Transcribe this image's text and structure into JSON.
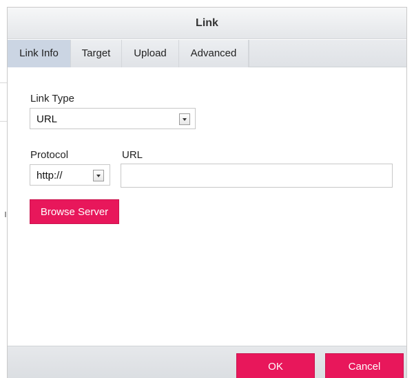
{
  "dialog": {
    "title": "Link"
  },
  "tabs": [
    {
      "label": "Link Info",
      "active": true
    },
    {
      "label": "Target",
      "active": false
    },
    {
      "label": "Upload",
      "active": false
    },
    {
      "label": "Advanced",
      "active": false
    }
  ],
  "link_type": {
    "label": "Link Type",
    "value": "URL"
  },
  "protocol": {
    "label": "Protocol",
    "value": "http://"
  },
  "url": {
    "label": "URL",
    "value": ""
  },
  "buttons": {
    "browse_server": "Browse Server",
    "ok": "OK",
    "cancel": "Cancel"
  },
  "colors": {
    "accent": "#e8175b",
    "active_tab": "#cbd5e3"
  }
}
